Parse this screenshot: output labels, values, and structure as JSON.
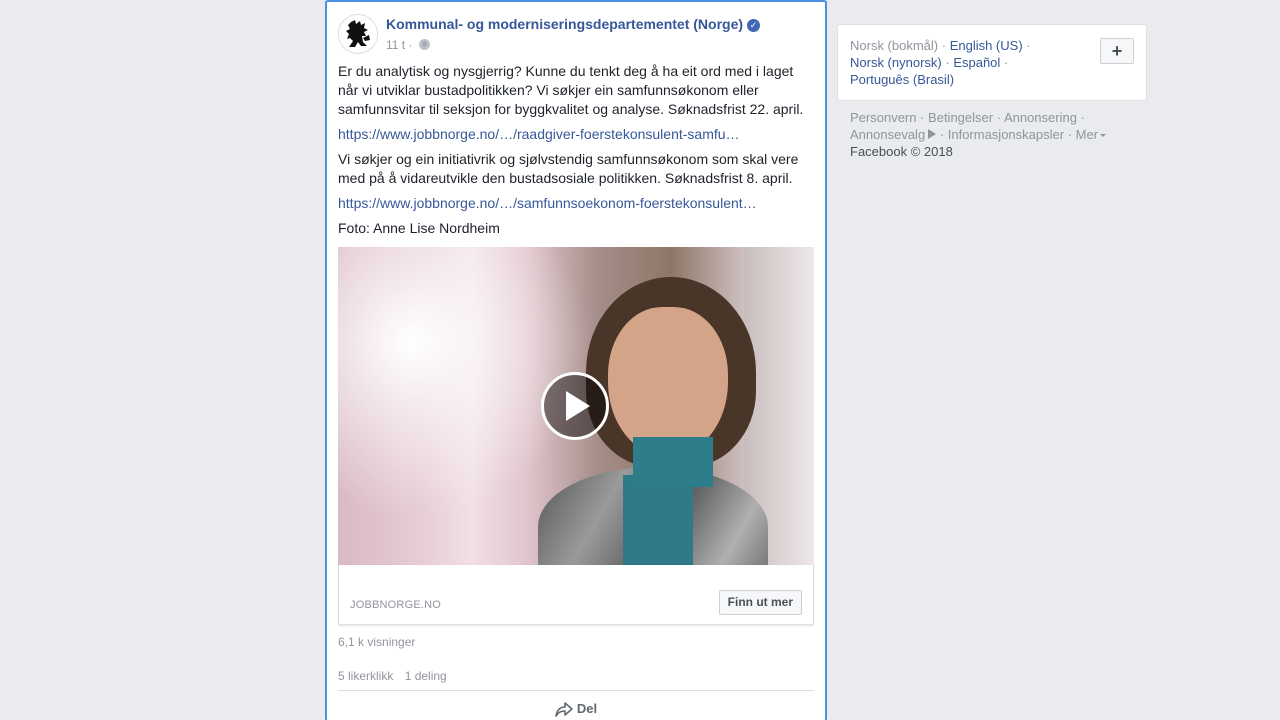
{
  "post": {
    "page_name": "Kommunal- og moderniseringsdepartementet (Norge)",
    "verified_icon": "verified-badge-icon",
    "time": "11 t",
    "time_sep": " · ",
    "privacy_icon": "globe-icon",
    "paragraph_1": "Er du analytisk og nysgjerrig? Kunne du tenkt deg å ha eit ord med i laget når vi utviklar bustadpolitikken? Vi søkjer ein samfunnsøkonom eller samfunnsvitar til seksjon for byggkvalitet og analyse. Søknadsfrist 22. april.",
    "link_1": "https://www.jobbnorge.no/…/raadgiver-foerstekonsulent-samfu…",
    "paragraph_2": "Vi søkjer og ein initiativrik og sjølvstendig samfunnsøkonom som skal vere med på å vidareutvikle den bustadsosiale politikken. Søknadsfrist 8. april.",
    "link_2": "https://www.jobbnorge.no/…/samfunnsoekonom-foerstekonsulent…",
    "photo_credit": "Foto: Anne Lise Nordheim",
    "card": {
      "domain": "JOBBNORGE.NO",
      "cta_label": "Finn ut mer"
    },
    "views": "6,1 k visninger",
    "likes": "5 likerklikk",
    "shares": "1 deling",
    "share_label": "Del"
  },
  "languages": {
    "current": "Norsk (bokmål)",
    "options": [
      "English (US)",
      "Norsk (nynorsk)",
      "Español",
      "Português (Brasil)"
    ],
    "separator": " · "
  },
  "footer": {
    "links": [
      "Personvern",
      "Betingelser",
      "Annonsering",
      "Annonsevalg",
      "Informasjonskapsler",
      "Mer"
    ],
    "separator": " · ",
    "copyright": "Facebook © 2018"
  }
}
